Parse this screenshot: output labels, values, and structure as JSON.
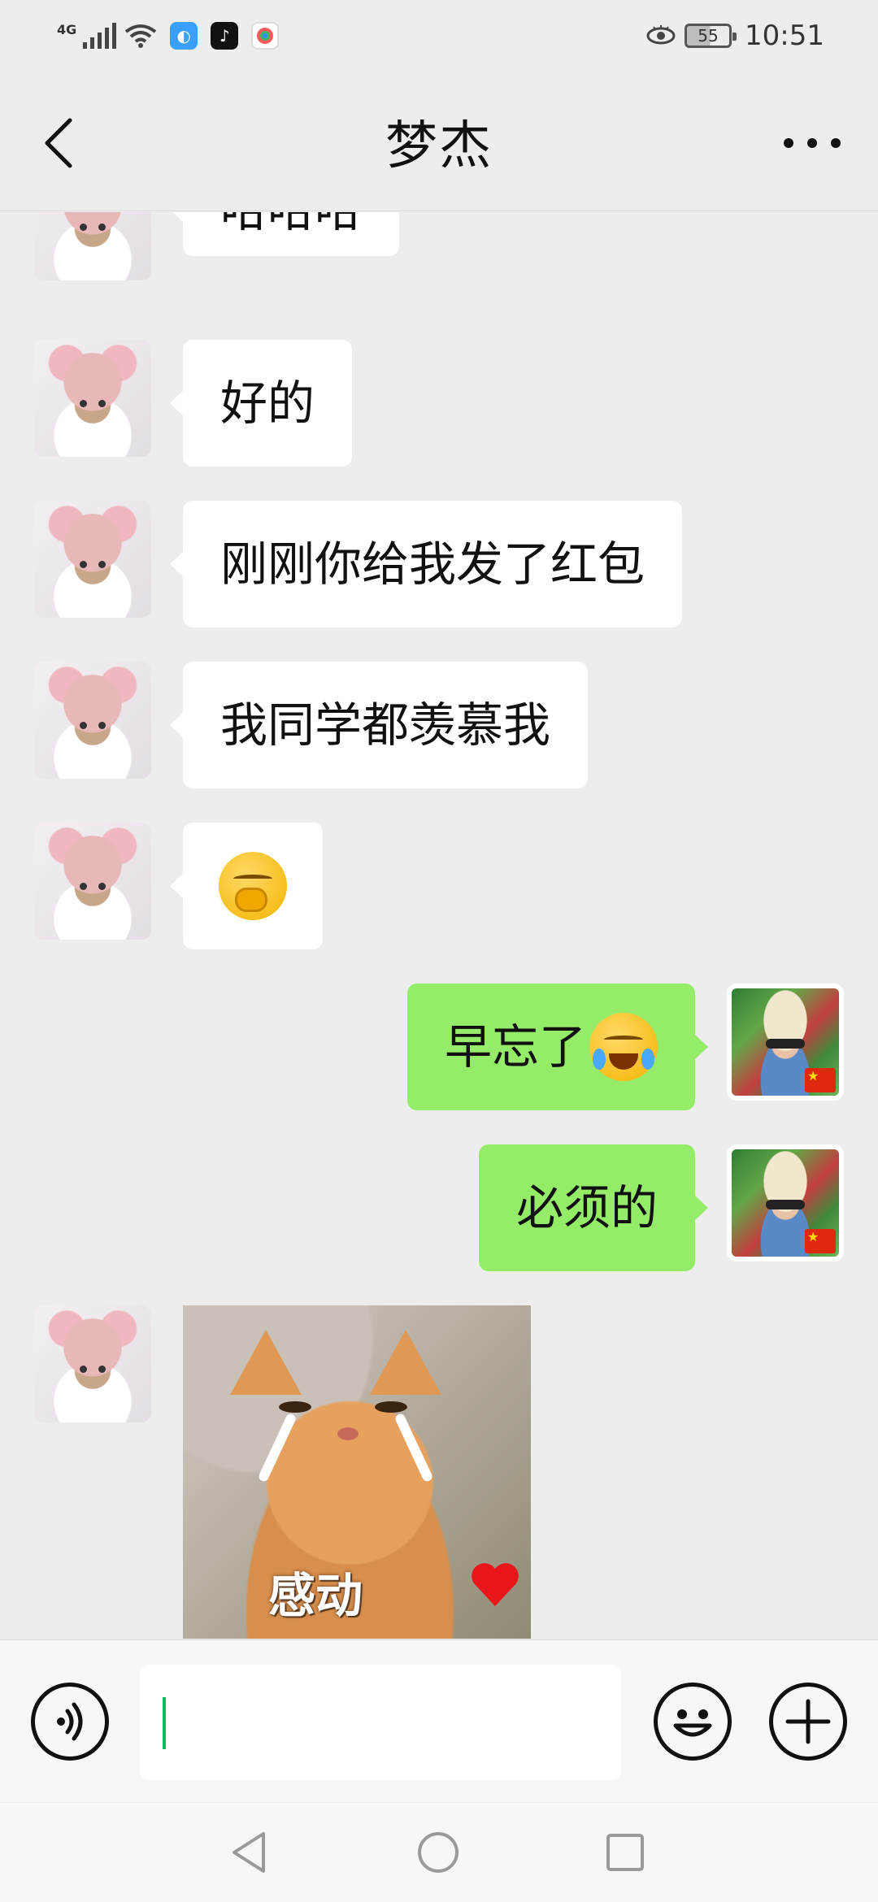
{
  "status_bar": {
    "network": "4G",
    "time": "10:51",
    "battery": "55",
    "app_icons": [
      "browser-icon",
      "tiktok-icon",
      "app-icon"
    ]
  },
  "header": {
    "title": "梦杰"
  },
  "messages": [
    {
      "side": "left",
      "type": "text",
      "text": "哈哈哈"
    },
    {
      "side": "left",
      "type": "text",
      "text": "好的"
    },
    {
      "side": "left",
      "type": "text",
      "text": "刚刚你给我发了红包"
    },
    {
      "side": "left",
      "type": "text",
      "text": "我同学都羡慕我"
    },
    {
      "side": "left",
      "type": "emoji",
      "emoji": "hand-over-mouth-emoji"
    },
    {
      "side": "right",
      "type": "text",
      "text": "早忘了",
      "emoji": "rofl-emoji"
    },
    {
      "side": "right",
      "type": "text",
      "text": "必须的"
    },
    {
      "side": "left",
      "type": "sticker",
      "caption": "感动",
      "emoji": "heart-icon"
    }
  ],
  "input": {
    "value": "",
    "placeholder": ""
  },
  "colors": {
    "background": "#ededed",
    "bubble_self": "#95ec69",
    "bubble_other": "#ffffff",
    "caret": "#07c160"
  }
}
